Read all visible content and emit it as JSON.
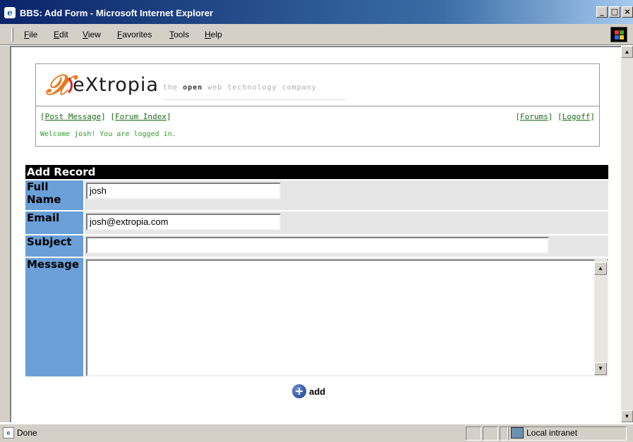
{
  "window": {
    "title": "BBS: Add Form - Microsoft Internet Explorer",
    "icon": "ie-icon",
    "controls": [
      "_",
      "□",
      "×"
    ]
  },
  "menu": {
    "items": [
      "File",
      "Edit",
      "View",
      "Favorites",
      "Tools",
      "Help"
    ]
  },
  "header": {
    "logo_text": "eXtropia",
    "tagline_pre": "the ",
    "tagline_bold": "open",
    "tagline_post": " web technology company",
    "nav_left": [
      {
        "label": "Post Message"
      },
      {
        "label": "Forum Index"
      }
    ],
    "nav_right": [
      {
        "label": "Forums"
      },
      {
        "label": "Logoff"
      }
    ],
    "welcome": "Welcome josh! You are logged in."
  },
  "form": {
    "title": "Add Record",
    "fields": {
      "full_name_label": "Full Name",
      "full_name_value": "josh",
      "email_label": "Email",
      "email_value": "josh@extropia.com",
      "subject_label": "Subject",
      "subject_value": "",
      "message_label": "Message",
      "message_value": ""
    },
    "add_label": "add"
  },
  "status": {
    "text": "Done",
    "zone": "Local intranet"
  },
  "colors": {
    "label_bg": "#6a9fd8",
    "header_bar": "#000000",
    "link_green": "#1a6b1a"
  }
}
